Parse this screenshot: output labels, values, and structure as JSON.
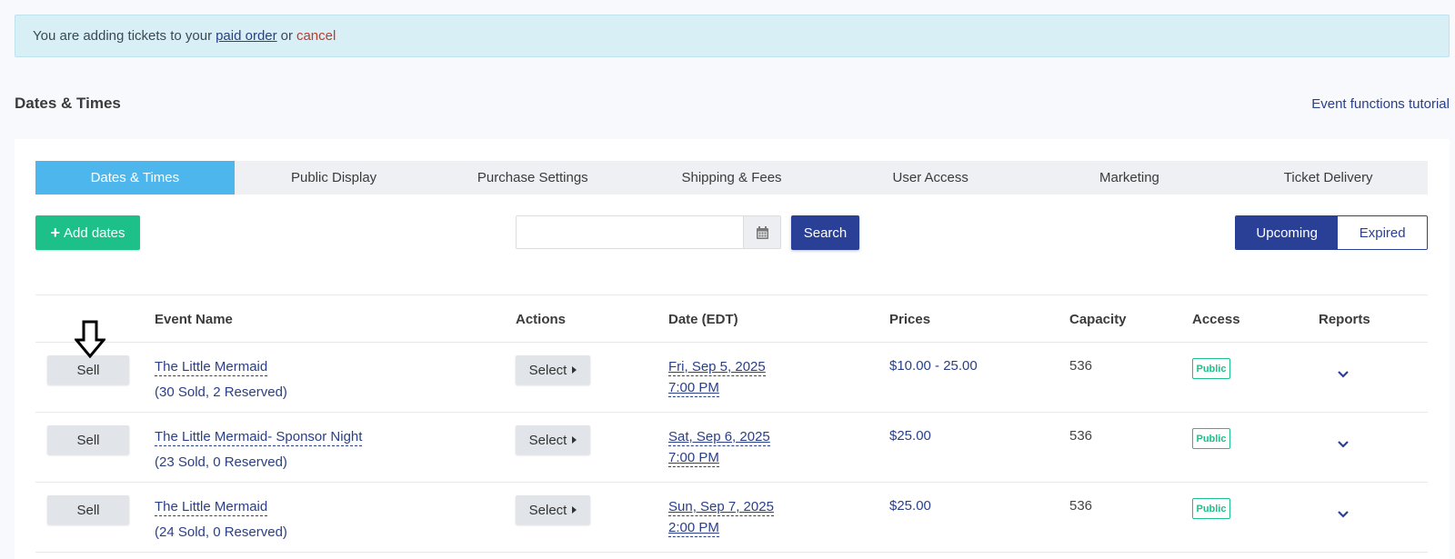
{
  "notice": {
    "prefix": "You are adding tickets to your",
    "paid_link": "paid order",
    "middle": "or",
    "cancel_link": "cancel"
  },
  "section_title": "Dates & Times",
  "tutorial_link": "Event functions tutorial",
  "tabs": [
    {
      "label": "Dates & Times",
      "active": true
    },
    {
      "label": "Public Display",
      "active": false
    },
    {
      "label": "Purchase Settings",
      "active": false
    },
    {
      "label": "Shipping & Fees",
      "active": false
    },
    {
      "label": "User Access",
      "active": false
    },
    {
      "label": "Marketing",
      "active": false
    },
    {
      "label": "Ticket Delivery",
      "active": false
    }
  ],
  "toolbar": {
    "add_label": "Add dates",
    "search_value": "",
    "search_button": "Search",
    "upcoming": "Upcoming",
    "expired": "Expired"
  },
  "table": {
    "headers": {
      "event_name": "Event Name",
      "actions": "Actions",
      "date": "Date (EDT)",
      "prices": "Prices",
      "capacity": "Capacity",
      "access": "Access",
      "reports": "Reports"
    },
    "rows": [
      {
        "sell": "Sell",
        "name": "The Little Mermaid",
        "sub": "(30 Sold, 2 Reserved)",
        "select": "Select",
        "date": "Fri, Sep 5, 2025",
        "time": "7:00 PM",
        "price": "$10.00 - 25.00",
        "capacity": "536",
        "access": "Public"
      },
      {
        "sell": "Sell",
        "name": "The Little Mermaid- Sponsor Night",
        "sub": "(23 Sold, 0 Reserved)",
        "select": "Select",
        "date": "Sat, Sep 6, 2025",
        "time": "7:00 PM",
        "price": "$25.00",
        "capacity": "536",
        "access": "Public"
      },
      {
        "sell": "Sell",
        "name": "The Little Mermaid",
        "sub": "(24 Sold, 0 Reserved)",
        "select": "Select",
        "date": "Sun, Sep 7, 2025",
        "time": "2:00 PM",
        "price": "$25.00",
        "capacity": "536",
        "access": "Public"
      }
    ]
  },
  "colors": {
    "accent": "#2a3f96",
    "tab_active": "#4db6ec",
    "add_button": "#1ec08a",
    "notice_bg": "#d9eff6"
  }
}
